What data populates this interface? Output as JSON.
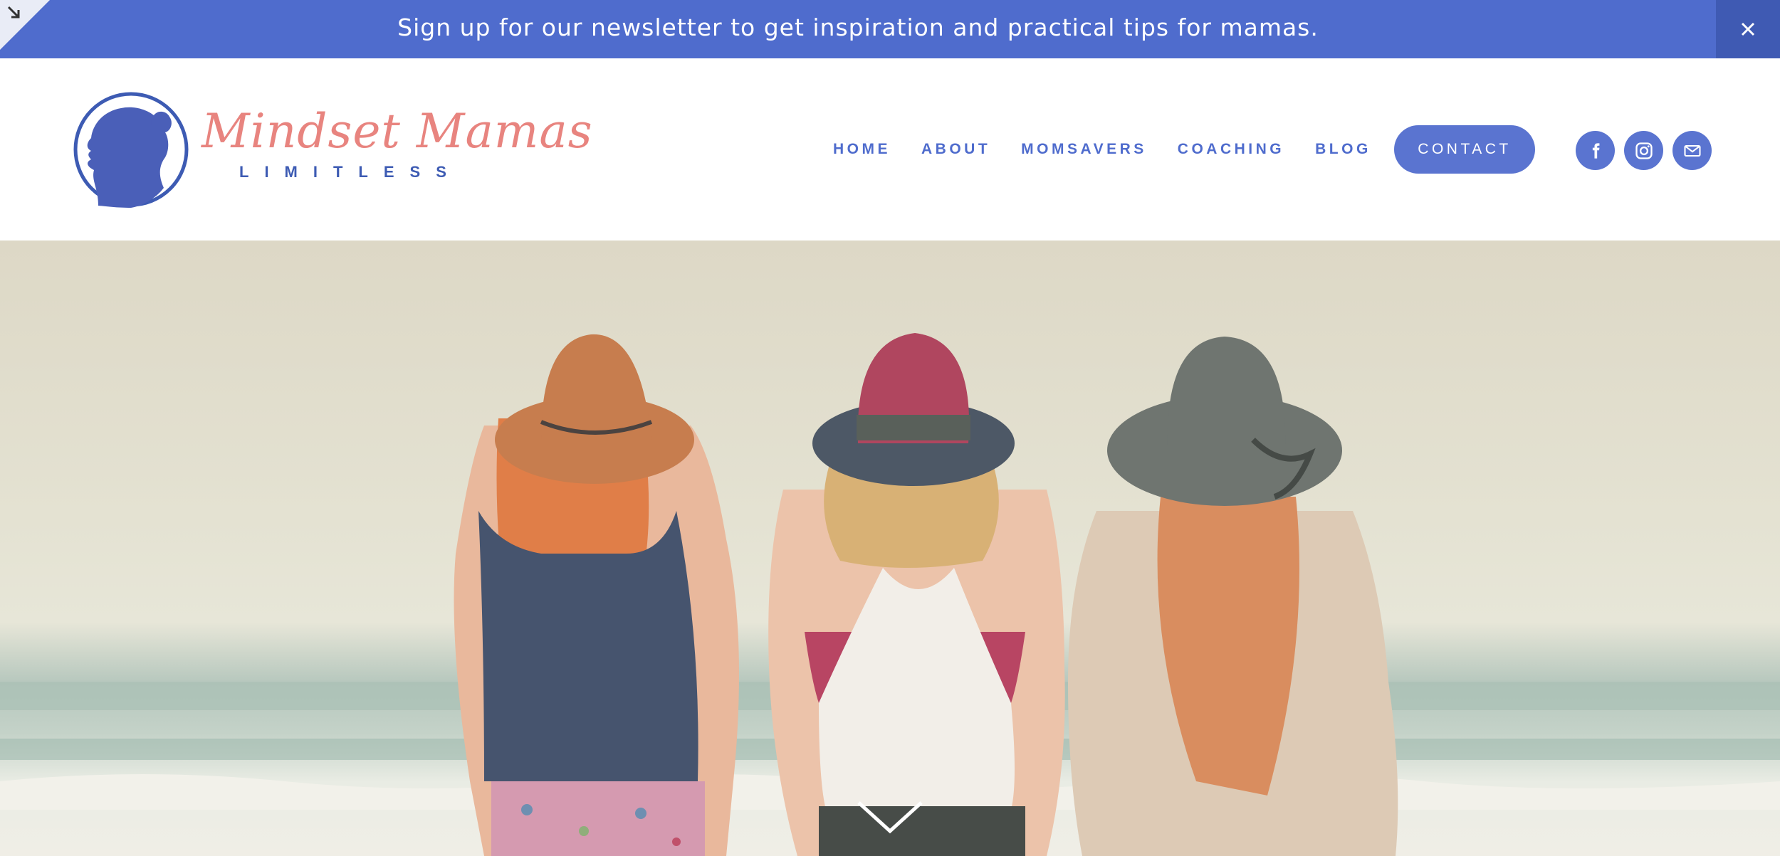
{
  "announcement": {
    "message": "Sign up for our newsletter to get inspiration and practical tips for mamas.",
    "close_icon": "close-icon",
    "corner_icon": "arrow-down-right-icon"
  },
  "logo": {
    "script_text": "Mindset Mamas",
    "sub_text": "LIMITLESS",
    "emblem_icon": "woman-silhouette-icon"
  },
  "nav": {
    "items": [
      "HOME",
      "ABOUT",
      "MOMSAVERS",
      "COACHING",
      "BLOG"
    ],
    "contact_label": "CONTACT"
  },
  "social": {
    "icons": [
      "facebook-icon",
      "instagram-icon",
      "email-icon"
    ]
  },
  "hero": {
    "image": "three-women-in-hats-at-beach",
    "scroll_icon": "chevron-down-icon"
  },
  "colors": {
    "brand_blue": "#4f6ccd",
    "logo_coral": "#e8847f",
    "logo_navy": "#3d5bb3"
  }
}
